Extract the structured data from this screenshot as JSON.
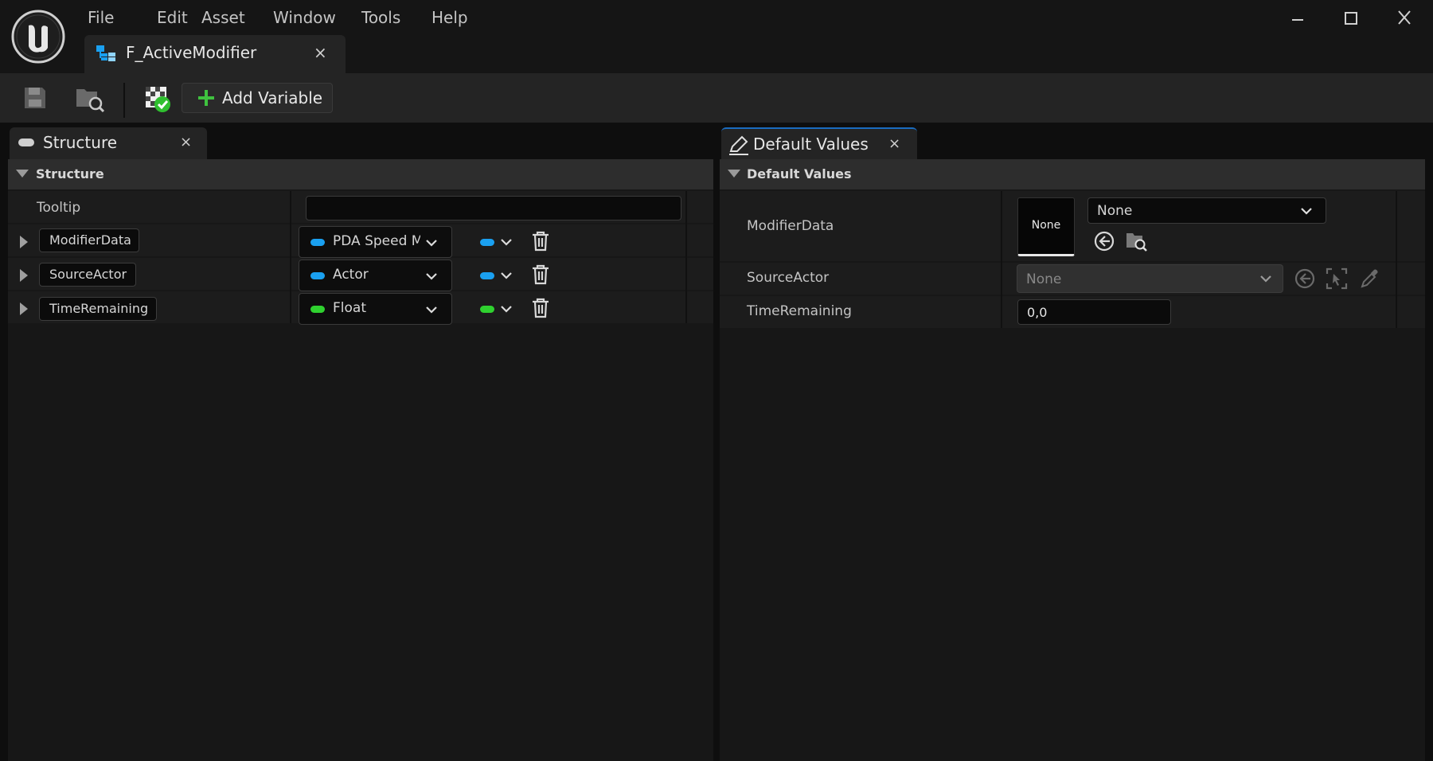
{
  "menu": [
    "File",
    "Edit",
    "Asset",
    "Window",
    "Tools",
    "Help"
  ],
  "document_tab": {
    "label": "F_ActiveModifier",
    "close": "×"
  },
  "toolbar": {
    "add_variable_label": "Add Variable"
  },
  "structure_panel": {
    "tab_label": "Structure",
    "tab_close": "×",
    "section_label": "Structure",
    "tooltip_label": "Tooltip",
    "tooltip_value": "",
    "members": [
      {
        "name": "ModifierData",
        "type": "PDA Speed Modifier",
        "pin_color": "#1aa0f0"
      },
      {
        "name": "SourceActor",
        "type": "Actor",
        "pin_color": "#1aa0f0"
      },
      {
        "name": "TimeRemaining",
        "type": "Float",
        "pin_color": "#2fd12f"
      }
    ]
  },
  "defaults_panel": {
    "tab_label": "Default Values",
    "tab_close": "×",
    "section_label": "Default Values",
    "modifier_data": {
      "label": "ModifierData",
      "thumbnail_text": "None",
      "dropdown_value": "None"
    },
    "source_actor": {
      "label": "SourceActor",
      "dropdown_value": "None"
    },
    "time_remaining": {
      "label": "TimeRemaining",
      "value": "0,0"
    }
  },
  "colors": {
    "accent_blue": "#1aa0f0",
    "float_green": "#2fd12f",
    "add_green": "#3fc23f"
  }
}
